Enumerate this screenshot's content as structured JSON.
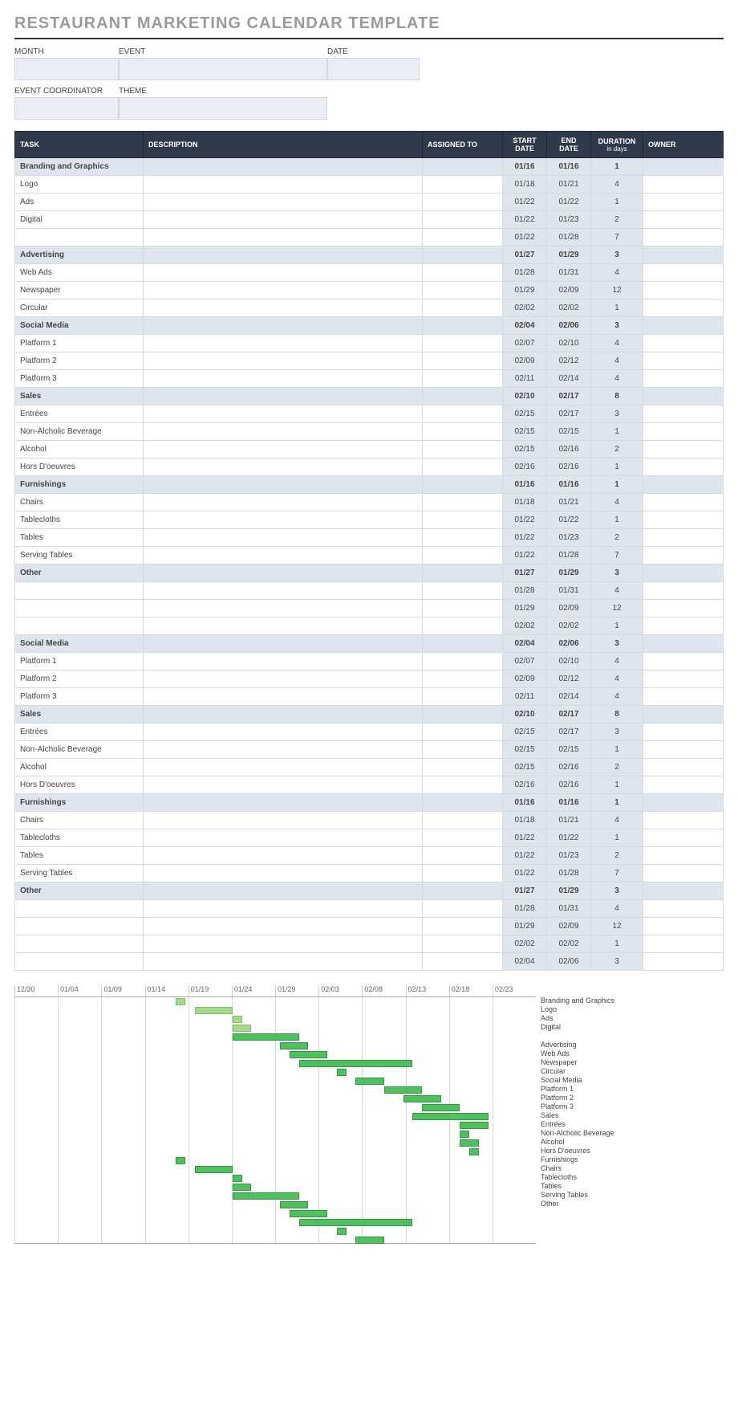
{
  "title": "RESTAURANT MARKETING CALENDAR TEMPLATE",
  "meta": {
    "month_label": "MONTH",
    "event_label": "EVENT",
    "date_label": "DATE",
    "coord_label": "EVENT COORDINATOR",
    "theme_label": "THEME"
  },
  "columns": {
    "task": "TASK",
    "description": "DESCRIPTION",
    "assigned": "ASSIGNED TO",
    "start": "START DATE",
    "end": "END DATE",
    "duration": "DURATION",
    "duration_sub": "in days",
    "owner": "OWNER"
  },
  "rows": [
    {
      "section": true,
      "task": "Branding and Graphics",
      "start": "01/16",
      "end": "01/16",
      "dur": "1"
    },
    {
      "task": "Logo",
      "start": "01/18",
      "end": "01/21",
      "dur": "4"
    },
    {
      "task": "Ads",
      "start": "01/22",
      "end": "01/22",
      "dur": "1"
    },
    {
      "task": "Digital",
      "start": "01/22",
      "end": "01/23",
      "dur": "2"
    },
    {
      "task": "",
      "start": "01/22",
      "end": "01/28",
      "dur": "7"
    },
    {
      "section": true,
      "task": "Advertising",
      "start": "01/27",
      "end": "01/29",
      "dur": "3"
    },
    {
      "task": "Web Ads",
      "start": "01/28",
      "end": "01/31",
      "dur": "4"
    },
    {
      "task": "Newspaper",
      "start": "01/29",
      "end": "02/09",
      "dur": "12"
    },
    {
      "task": "Circular",
      "start": "02/02",
      "end": "02/02",
      "dur": "1"
    },
    {
      "section": true,
      "task": "Social Media",
      "start": "02/04",
      "end": "02/06",
      "dur": "3"
    },
    {
      "task": "Platform 1",
      "start": "02/07",
      "end": "02/10",
      "dur": "4"
    },
    {
      "task": "Platform 2",
      "start": "02/09",
      "end": "02/12",
      "dur": "4"
    },
    {
      "task": "Platform 3",
      "start": "02/11",
      "end": "02/14",
      "dur": "4"
    },
    {
      "section": true,
      "task": "Sales",
      "start": "02/10",
      "end": "02/17",
      "dur": "8"
    },
    {
      "task": "Entrées",
      "start": "02/15",
      "end": "02/17",
      "dur": "3"
    },
    {
      "task": "Non-Alcholic Beverage",
      "start": "02/15",
      "end": "02/15",
      "dur": "1"
    },
    {
      "task": "Alcohol",
      "start": "02/15",
      "end": "02/16",
      "dur": "2"
    },
    {
      "task": "Hors D'oeuvres",
      "start": "02/16",
      "end": "02/16",
      "dur": "1"
    },
    {
      "section": true,
      "task": "Furnishings",
      "start": "01/16",
      "end": "01/16",
      "dur": "1"
    },
    {
      "task": "Chairs",
      "start": "01/18",
      "end": "01/21",
      "dur": "4"
    },
    {
      "task": "Tablecloths",
      "start": "01/22",
      "end": "01/22",
      "dur": "1"
    },
    {
      "task": "Tables",
      "start": "01/22",
      "end": "01/23",
      "dur": "2"
    },
    {
      "task": "Serving Tables",
      "start": "01/22",
      "end": "01/28",
      "dur": "7"
    },
    {
      "section": true,
      "task": "Other",
      "start": "01/27",
      "end": "01/29",
      "dur": "3"
    },
    {
      "task": "",
      "start": "01/28",
      "end": "01/31",
      "dur": "4"
    },
    {
      "task": "",
      "start": "01/29",
      "end": "02/09",
      "dur": "12"
    },
    {
      "task": "",
      "start": "02/02",
      "end": "02/02",
      "dur": "1"
    },
    {
      "section": true,
      "task": "Social Media",
      "start": "02/04",
      "end": "02/06",
      "dur": "3"
    },
    {
      "task": "Platform 1",
      "start": "02/07",
      "end": "02/10",
      "dur": "4"
    },
    {
      "task": "Platform 2",
      "start": "02/09",
      "end": "02/12",
      "dur": "4"
    },
    {
      "task": "Platform 3",
      "start": "02/11",
      "end": "02/14",
      "dur": "4"
    },
    {
      "section": true,
      "task": "Sales",
      "start": "02/10",
      "end": "02/17",
      "dur": "8"
    },
    {
      "task": "Entrées",
      "start": "02/15",
      "end": "02/17",
      "dur": "3"
    },
    {
      "task": "Non-Alcholic Beverage",
      "start": "02/15",
      "end": "02/15",
      "dur": "1"
    },
    {
      "task": "Alcohol",
      "start": "02/15",
      "end": "02/16",
      "dur": "2"
    },
    {
      "task": "Hors D'oeuvres",
      "start": "02/16",
      "end": "02/16",
      "dur": "1"
    },
    {
      "section": true,
      "task": "Furnishings",
      "start": "01/16",
      "end": "01/16",
      "dur": "1"
    },
    {
      "task": "Chairs",
      "start": "01/18",
      "end": "01/21",
      "dur": "4"
    },
    {
      "task": "Tablecloths",
      "start": "01/22",
      "end": "01/22",
      "dur": "1"
    },
    {
      "task": "Tables",
      "start": "01/22",
      "end": "01/23",
      "dur": "2"
    },
    {
      "task": "Serving Tables",
      "start": "01/22",
      "end": "01/28",
      "dur": "7"
    },
    {
      "section": true,
      "task": "Other",
      "start": "01/27",
      "end": "01/29",
      "dur": "3"
    },
    {
      "task": "",
      "start": "01/28",
      "end": "01/31",
      "dur": "4"
    },
    {
      "task": "",
      "start": "01/29",
      "end": "02/09",
      "dur": "12"
    },
    {
      "task": "",
      "start": "02/02",
      "end": "02/02",
      "dur": "1"
    },
    {
      "task": "",
      "start": "02/04",
      "end": "02/06",
      "dur": "3"
    }
  ],
  "chart_data": {
    "type": "bar",
    "title": "",
    "xlabel": "",
    "ylabel": "",
    "axis_dates": [
      "12/30",
      "01/04",
      "01/09",
      "01/14",
      "01/19",
      "01/24",
      "01/29",
      "02/03",
      "02/08",
      "02/13",
      "02/18",
      "02/23"
    ],
    "origin": "12/30",
    "total_days": 55,
    "series": [
      {
        "name": "Branding and Graphics",
        "start": "01/16",
        "days": 1,
        "light": true
      },
      {
        "name": "Logo",
        "start": "01/18",
        "days": 4,
        "light": true
      },
      {
        "name": "Ads",
        "start": "01/22",
        "days": 1,
        "light": true
      },
      {
        "name": "Digital",
        "start": "01/22",
        "days": 2,
        "light": true
      },
      {
        "name": "",
        "start": "01/22",
        "days": 7
      },
      {
        "name": "Advertising",
        "start": "01/27",
        "days": 3
      },
      {
        "name": "Web Ads",
        "start": "01/28",
        "days": 4
      },
      {
        "name": "Newspaper",
        "start": "01/29",
        "days": 12
      },
      {
        "name": "Circular",
        "start": "02/02",
        "days": 1
      },
      {
        "name": "Social Media",
        "start": "02/04",
        "days": 3
      },
      {
        "name": "Platform 1",
        "start": "02/07",
        "days": 4
      },
      {
        "name": "Platform 2",
        "start": "02/09",
        "days": 4
      },
      {
        "name": "Platform 3",
        "start": "02/11",
        "days": 4
      },
      {
        "name": "Sales",
        "start": "02/10",
        "days": 8
      },
      {
        "name": "Entrées",
        "start": "02/15",
        "days": 3
      },
      {
        "name": "Non-Alcholic Beverage",
        "start": "02/15",
        "days": 1
      },
      {
        "name": "Alcohol",
        "start": "02/15",
        "days": 2
      },
      {
        "name": "Hors D'oeuvres",
        "start": "02/16",
        "days": 1
      },
      {
        "name": "Furnishings",
        "start": "01/16",
        "days": 1
      },
      {
        "name": "Chairs",
        "start": "01/18",
        "days": 4
      },
      {
        "name": "Tablecloths",
        "start": "01/22",
        "days": 1
      },
      {
        "name": "Tables",
        "start": "01/22",
        "days": 2
      },
      {
        "name": "Serving Tables",
        "start": "01/22",
        "days": 7
      },
      {
        "name": "Other",
        "start": "01/27",
        "days": 3
      },
      {
        "name": "",
        "start": "01/28",
        "days": 4
      },
      {
        "name": "",
        "start": "01/29",
        "days": 12
      },
      {
        "name": "",
        "start": "02/02",
        "days": 1
      },
      {
        "name": "",
        "start": "02/04",
        "days": 3
      }
    ]
  }
}
